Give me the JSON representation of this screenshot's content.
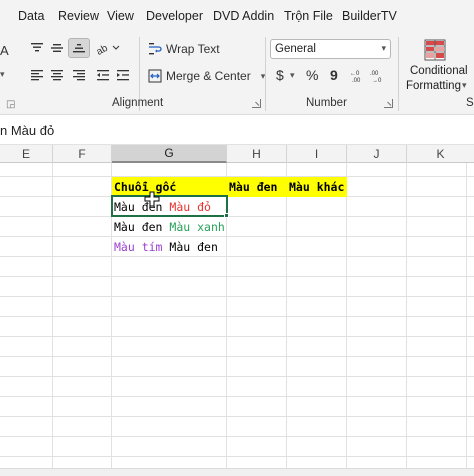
{
  "menu_tabs": [
    "Data",
    "Review",
    "View",
    "Developer",
    "DVD Addin",
    "Trộn File",
    "BuilderTV"
  ],
  "ribbon": {
    "font_size_fragment": "A",
    "wrap_text": "Wrap Text",
    "merge_center": "Merge & Center",
    "alignment_group": "Alignment",
    "number_format": "General",
    "currency_symbol": "$",
    "percent_symbol": "%",
    "comma_symbol": "9",
    "number_group": "Number",
    "conditional_formatting_line1": "Conditional",
    "conditional_formatting_line2": "Formatting",
    "styles_group_fragment": "S"
  },
  "formula_bar": {
    "text": "n Màu đỏ"
  },
  "columns": [
    "E",
    "F",
    "G",
    "H",
    "I",
    "J",
    "K"
  ],
  "selected_column": "G",
  "cells": {
    "G3": "Chuỗi gốc",
    "H3": "Màu đen",
    "I3": "Màu khác",
    "G4_a": "Màu đen",
    "G4_b": "Màu đỏ",
    "G5_a": "Màu đen",
    "G5_b": "Màu xanh",
    "G6_a": "Màu tím",
    "G6_b": "Màu đen"
  },
  "colors": {
    "header_fill": "#ffff00",
    "red_text": "#e8322d",
    "green_text": "#2aa05a",
    "purple_text": "#9b3fd1",
    "selection_border": "#1e7145"
  }
}
